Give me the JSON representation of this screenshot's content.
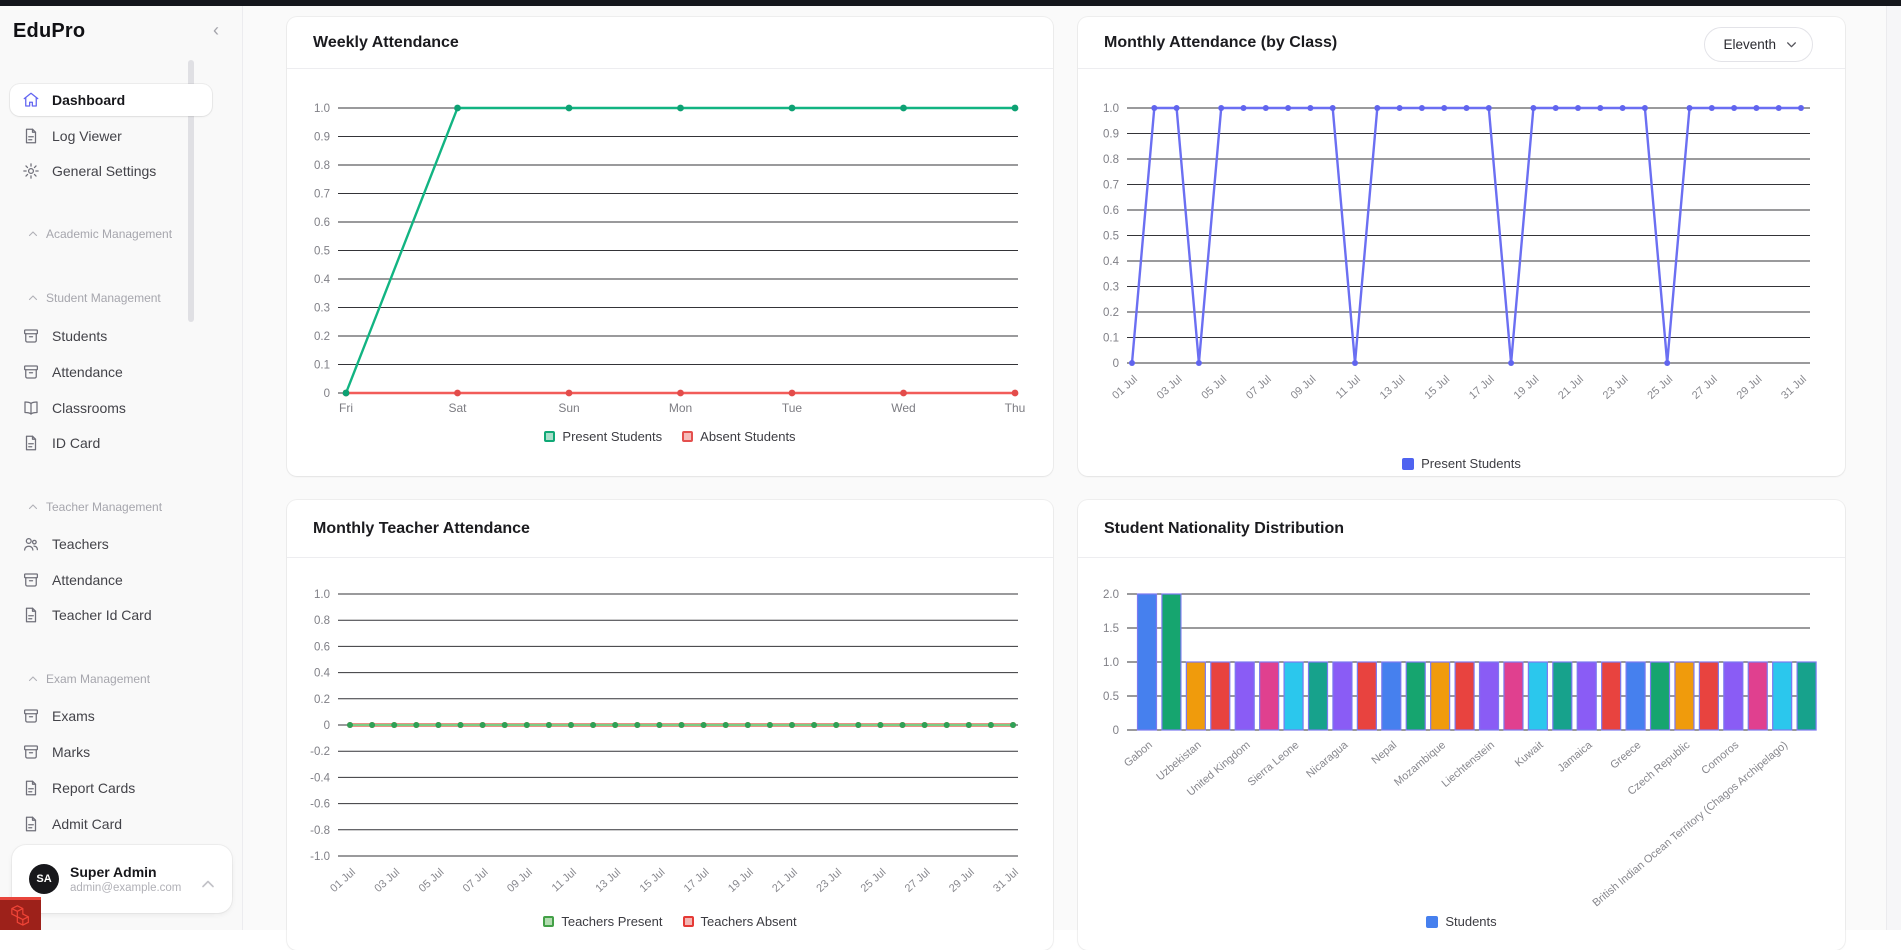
{
  "app": {
    "name": "EduPro"
  },
  "colors": {
    "accent": "#6366f1",
    "topbar": "#14161c"
  },
  "sidebar": {
    "collapse_icon": "‹",
    "items": [
      {
        "icon": "home",
        "label": "Dashboard",
        "active": true
      },
      {
        "icon": "document",
        "label": "Log Viewer"
      },
      {
        "icon": "gear",
        "label": "General Settings"
      },
      {
        "icon": "chevron-up",
        "label": "Academic Management",
        "header": true
      },
      {
        "icon": "chevron-up",
        "label": "Student Management",
        "header": true
      },
      {
        "icon": "archive",
        "label": "Students"
      },
      {
        "icon": "archive",
        "label": "Attendance"
      },
      {
        "icon": "book",
        "label": "Classrooms"
      },
      {
        "icon": "document",
        "label": "ID Card"
      },
      {
        "icon": "chevron-up",
        "label": "Teacher Management",
        "header": true
      },
      {
        "icon": "users",
        "label": "Teachers"
      },
      {
        "icon": "archive",
        "label": "Attendance"
      },
      {
        "icon": "document",
        "label": "Teacher Id Card"
      },
      {
        "icon": "chevron-up",
        "label": "Exam Management",
        "header": true
      },
      {
        "icon": "archive",
        "label": "Exams"
      },
      {
        "icon": "archive",
        "label": "Marks"
      },
      {
        "icon": "document",
        "label": "Report Cards"
      },
      {
        "icon": "document",
        "label": "Admit Card"
      }
    ],
    "user": {
      "initials": "SA",
      "name": "Super Admin",
      "email": "admin@example.com"
    }
  },
  "chart_data": [
    {
      "id": "weekly-attendance",
      "type": "line",
      "title": "Weekly Attendance",
      "categories": [
        "Fri",
        "Sat",
        "Sun",
        "Mon",
        "Tue",
        "Wed",
        "Thu"
      ],
      "series": [
        {
          "name": "Present Students",
          "values": [
            0,
            1,
            1,
            1,
            1,
            1,
            1
          ],
          "color": "#12b482",
          "point_color": "#0da173"
        },
        {
          "name": "Absent Students",
          "values": [
            0,
            0,
            0,
            0,
            0,
            0,
            0
          ],
          "color": "#f25c59",
          "point_color": "#e34c4a"
        }
      ],
      "ylim": [
        0,
        1
      ],
      "yticks": [
        1,
        0.9,
        0.8,
        0.7,
        0.6,
        0.5,
        0.4,
        0.3,
        0.2,
        0.1,
        0
      ],
      "ytick_labels": [
        "1.0",
        "0.9",
        "0.8",
        "0.7",
        "0.6",
        "0.5",
        "0.4",
        "0.3",
        "0.2",
        "0.1",
        "0"
      ],
      "legend": [
        {
          "label": "Present Students",
          "style": "outlined",
          "color": "#10a876",
          "fill": "#a9dfca"
        },
        {
          "label": "Absent Students",
          "style": "outlined",
          "color": "#e4504e",
          "fill": "#f6bcba"
        }
      ],
      "grid": true,
      "legend_position": "bottom",
      "x_rotated": false
    },
    {
      "id": "monthly-attendance-by-class",
      "type": "line",
      "title": "Monthly Attendance (by Class)",
      "filter_label": "Eleventh",
      "categories": [
        "01 Jul",
        "02 Jul",
        "03 Jul",
        "04 Jul",
        "05 Jul",
        "06 Jul",
        "07 Jul",
        "08 Jul",
        "09 Jul",
        "10 Jul",
        "11 Jul",
        "12 Jul",
        "13 Jul",
        "14 Jul",
        "15 Jul",
        "16 Jul",
        "17 Jul",
        "18 Jul",
        "19 Jul",
        "20 Jul",
        "21 Jul",
        "22 Jul",
        "23 Jul",
        "24 Jul",
        "25 Jul",
        "26 Jul",
        "27 Jul",
        "28 Jul",
        "29 Jul",
        "30 Jul",
        "31 Jul"
      ],
      "tick_every": 2,
      "series": [
        {
          "name": "Present Students",
          "values": [
            0,
            1,
            1,
            0,
            1,
            1,
            1,
            1,
            1,
            1,
            0,
            1,
            1,
            1,
            1,
            1,
            1,
            0,
            1,
            1,
            1,
            1,
            1,
            1,
            0,
            1,
            1,
            1,
            1,
            1,
            1
          ],
          "color": "#6b6ff2",
          "point_color": "#6064ee"
        }
      ],
      "ylim": [
        0,
        1
      ],
      "yticks": [
        1,
        0.9,
        0.8,
        0.7,
        0.6,
        0.5,
        0.4,
        0.3,
        0.2,
        0.1,
        0
      ],
      "ytick_labels": [
        "1.0",
        "0.9",
        "0.8",
        "0.7",
        "0.6",
        "0.5",
        "0.4",
        "0.3",
        "0.2",
        "0.1",
        "0"
      ],
      "legend": [
        {
          "label": "Present Students",
          "style": "solid",
          "color": "#4f63f0"
        }
      ],
      "grid": true,
      "legend_position": "bottom",
      "x_rotated": true
    },
    {
      "id": "monthly-teacher-attendance",
      "type": "line",
      "title": "Monthly Teacher Attendance",
      "categories": [
        "01 Jul",
        "02 Jul",
        "03 Jul",
        "04 Jul",
        "05 Jul",
        "06 Jul",
        "07 Jul",
        "08 Jul",
        "09 Jul",
        "10 Jul",
        "11 Jul",
        "12 Jul",
        "13 Jul",
        "14 Jul",
        "15 Jul",
        "16 Jul",
        "17 Jul",
        "18 Jul",
        "19 Jul",
        "20 Jul",
        "21 Jul",
        "22 Jul",
        "23 Jul",
        "24 Jul",
        "25 Jul",
        "26 Jul",
        "27 Jul",
        "28 Jul",
        "29 Jul",
        "30 Jul",
        "31 Jul"
      ],
      "tick_every": 2,
      "series": [
        {
          "name": "Teachers Present",
          "values": [
            0,
            0,
            0,
            0,
            0,
            0,
            0,
            0,
            0,
            0,
            0,
            0,
            0,
            0,
            0,
            0,
            0,
            0,
            0,
            0,
            0,
            0,
            0,
            0,
            0,
            0,
            0,
            0,
            0,
            0,
            0
          ],
          "color": "#7fcd84",
          "point_color": "#2fa156"
        },
        {
          "name": "Teachers Absent",
          "values": [
            0,
            0,
            0,
            0,
            0,
            0,
            0,
            0,
            0,
            0,
            0,
            0,
            0,
            0,
            0,
            0,
            0,
            0,
            0,
            0,
            0,
            0,
            0,
            0,
            0,
            0,
            0,
            0,
            0,
            0,
            0
          ],
          "color": "#f25c59",
          "point_color": "#e34c4a"
        }
      ],
      "ylim": [
        -1,
        1
      ],
      "yticks": [
        1,
        0.8,
        0.6,
        0.4,
        0.2,
        0,
        -0.2,
        -0.4,
        -0.6,
        -0.8,
        -1
      ],
      "ytick_labels": [
        "1.0",
        "0.8",
        "0.6",
        "0.4",
        "0.2",
        "0",
        "-0.2",
        "-0.4",
        "-0.6",
        "-0.8",
        "-1.0"
      ],
      "legend": [
        {
          "label": "Teachers Present",
          "style": "outlined",
          "color": "#43a047",
          "fill": "#b2dcb0"
        },
        {
          "label": "Teachers Absent",
          "style": "outlined",
          "color": "#e53935",
          "fill": "#f3b6b3"
        }
      ],
      "grid": true,
      "legend_position": "bottom",
      "x_rotated": true
    },
    {
      "id": "student-nationality-distribution",
      "type": "bar",
      "title": "Student Nationality Distribution",
      "categories": [
        "Gabon",
        "",
        "Uzbekistan",
        "",
        "United Kingdom",
        "",
        "Sierra Leone",
        "",
        "Nicaragua",
        "",
        "Nepal",
        "",
        "Mozambique",
        "",
        "Liechtenstein",
        "",
        "Kuwait",
        "",
        "Jamaica",
        "",
        "Greece",
        "",
        "Czech Republic",
        "",
        "Comoros",
        "",
        "British Indian Ocean Territory (Chagos Archipelago)",
        ""
      ],
      "values": [
        2,
        2,
        1,
        1,
        1,
        1,
        1,
        1,
        1,
        1,
        1,
        1,
        1,
        1,
        1,
        1,
        1,
        1,
        1,
        1,
        1,
        1,
        1,
        1,
        1,
        1,
        1,
        1
      ],
      "colors": [
        "#4680ee",
        "#16a56f",
        "#f09b0c",
        "#e8433f",
        "#8a5cf5",
        "#e0408f",
        "#2bc7ed",
        "#17a28c",
        "#8a5cf5",
        "#e8433f",
        "#4680ee",
        "#16a56f",
        "#f09b0c",
        "#e8433f",
        "#8a5cf5",
        "#e0408f",
        "#2bc7ed",
        "#17a28c",
        "#8a5cf5",
        "#e8433f",
        "#4680ee",
        "#16a56f",
        "#f09b0c",
        "#e8433f",
        "#8a5cf5",
        "#e0408f",
        "#2bc7ed",
        "#17a28c"
      ],
      "bar_border_color": "#7b79f0",
      "ylim": [
        0,
        2
      ],
      "yticks": [
        2,
        1.5,
        1,
        0.5,
        0
      ],
      "ytick_labels": [
        "2.0",
        "1.5",
        "1.0",
        "0.5",
        "0"
      ],
      "legend": [
        {
          "label": "Students",
          "style": "solid",
          "color": "#4680ee"
        }
      ],
      "grid": true,
      "legend_position": "bottom",
      "x_rotated": true
    }
  ]
}
